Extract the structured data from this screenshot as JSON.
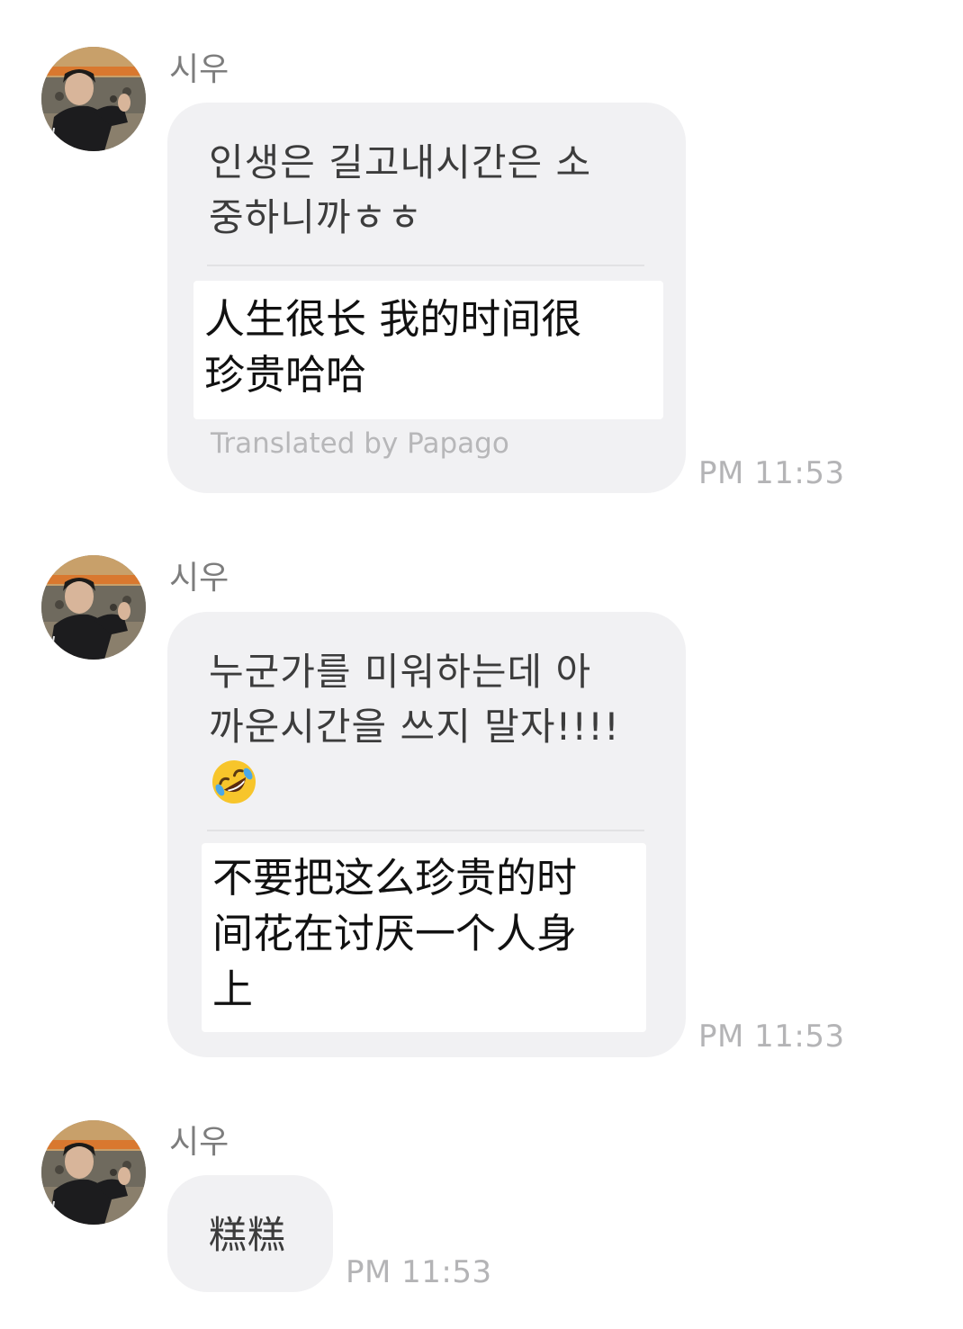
{
  "messages": [
    {
      "sender": "시우",
      "text": "인생은 길고내시간은 소\n중하니까ㅎㅎ",
      "translation": "人生很长 我的时间很\n珍贵哈哈",
      "credit": "Translated by Papago",
      "time": "PM 11:53"
    },
    {
      "sender": "시우",
      "text": "누군가를 미워하는데 아\n까운시간을 쓰지 말자!!!!",
      "emoji": "rolling-on-floor-laughing-emoji",
      "translation": "不要把这么珍贵的时\n间花在讨厌一个人身\n上",
      "time": "PM 11:53"
    },
    {
      "sender": "시우",
      "text": "糕糕",
      "time": "PM 11:53"
    }
  ]
}
